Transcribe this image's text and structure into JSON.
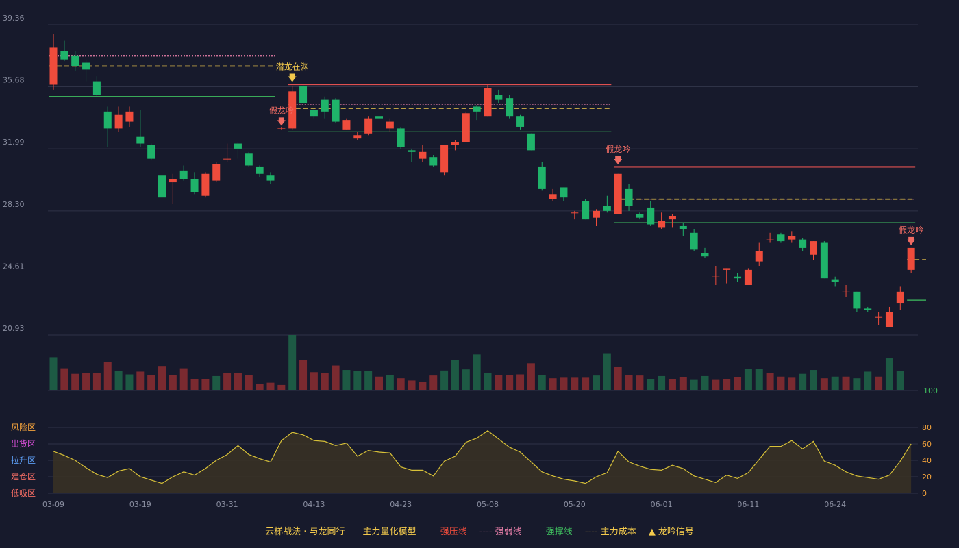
{
  "colors": {
    "background": "#171a2c",
    "grid": "#2f3347",
    "up": "#ef4c3c",
    "down": "#1fb36a",
    "resistance": "#e05050",
    "weak": "#e77ea8",
    "support": "#3fbf5f",
    "cost": "#f2c94c",
    "oscillator": "#d8c138",
    "axis_text": "#8a8ea0"
  },
  "chart_data": [
    {
      "type": "candlestick",
      "title": "",
      "ylim": [
        20.93,
        39.36
      ],
      "y_ticks": [
        "39.36",
        "35.68",
        "31.99",
        "28.30",
        "24.61",
        "20.93"
      ],
      "y_tick_values": [
        39.36,
        35.68,
        31.99,
        28.3,
        24.61,
        20.93
      ],
      "ohlc": [
        [
          35.8,
          38.0,
          35.5,
          38.8
        ],
        [
          37.8,
          37.3,
          37.2,
          38.4
        ],
        [
          37.5,
          36.9,
          36.6,
          37.8
        ],
        [
          37.1,
          36.7,
          36.0,
          37.3
        ],
        [
          36.0,
          35.2,
          35.1,
          36.3
        ],
        [
          34.2,
          33.2,
          32.1,
          34.5
        ],
        [
          33.2,
          34.0,
          33.0,
          34.5
        ],
        [
          33.6,
          34.2,
          33.3,
          34.5
        ],
        [
          32.7,
          32.3,
          32.1,
          34.3
        ],
        [
          32.2,
          31.4,
          31.3,
          32.3
        ],
        [
          30.4,
          29.1,
          28.9,
          30.5
        ],
        [
          30.0,
          30.2,
          28.7,
          30.5
        ],
        [
          30.7,
          30.2,
          30.1,
          31.0
        ],
        [
          30.2,
          29.4,
          29.3,
          30.6
        ],
        [
          29.2,
          30.5,
          29.1,
          30.6
        ],
        [
          30.1,
          31.1,
          30.0,
          31.2
        ],
        [
          31.4,
          31.4,
          31.2,
          32.3
        ],
        [
          32.3,
          32.0,
          31.4,
          32.4
        ],
        [
          31.7,
          31.0,
          30.9,
          31.8
        ],
        [
          30.9,
          30.5,
          30.3,
          31.0
        ],
        [
          30.4,
          30.1,
          29.9,
          30.6
        ],
        [
          33.2,
          33.2,
          33.1,
          33.3
        ],
        [
          33.2,
          35.4,
          33.1,
          35.7
        ],
        [
          35.7,
          34.7,
          34.5,
          35.8
        ],
        [
          34.3,
          33.9,
          33.8,
          34.4
        ],
        [
          34.9,
          34.2,
          33.8,
          35.1
        ],
        [
          34.9,
          33.6,
          33.5,
          35.0
        ],
        [
          33.1,
          33.7,
          33.1,
          33.8
        ],
        [
          32.6,
          32.8,
          32.5,
          33.0
        ],
        [
          32.9,
          33.8,
          32.8,
          33.9
        ],
        [
          33.9,
          33.8,
          33.5,
          34.0
        ],
        [
          33.2,
          33.6,
          33.0,
          33.8
        ],
        [
          33.2,
          32.1,
          32.0,
          33.3
        ],
        [
          31.9,
          31.8,
          31.2,
          32.0
        ],
        [
          31.4,
          31.8,
          31.2,
          32.2
        ],
        [
          31.5,
          31.0,
          30.9,
          31.6
        ],
        [
          30.6,
          32.2,
          30.4,
          32.2
        ],
        [
          32.2,
          32.4,
          31.9,
          32.5
        ],
        [
          32.4,
          34.1,
          32.4,
          34.2
        ],
        [
          34.5,
          34.2,
          33.7,
          34.6
        ],
        [
          33.9,
          35.6,
          33.9,
          35.8
        ],
        [
          35.2,
          34.9,
          34.7,
          35.5
        ],
        [
          35.0,
          33.9,
          33.8,
          35.2
        ],
        [
          33.9,
          33.3,
          33.1,
          34.0
        ],
        [
          32.9,
          31.9,
          31.9,
          32.9
        ],
        [
          30.9,
          29.6,
          29.5,
          31.2
        ],
        [
          29.0,
          29.3,
          28.9,
          29.6
        ],
        [
          29.7,
          29.1,
          28.9,
          29.7
        ],
        [
          28.2,
          28.2,
          27.8,
          28.3
        ],
        [
          28.9,
          27.8,
          27.8,
          29.0
        ],
        [
          27.9,
          28.3,
          27.4,
          28.4
        ],
        [
          28.6,
          28.3,
          28.2,
          29.2
        ],
        [
          28.1,
          30.5,
          28.1,
          30.5
        ],
        [
          29.6,
          28.6,
          28.3,
          29.9
        ],
        [
          28.1,
          27.9,
          27.8,
          28.2
        ],
        [
          28.5,
          27.5,
          27.4,
          28.9
        ],
        [
          27.3,
          27.7,
          27.2,
          28.2
        ],
        [
          27.8,
          28.0,
          27.3,
          28.1
        ],
        [
          27.4,
          27.2,
          26.8,
          27.6
        ],
        [
          27.0,
          26.0,
          25.9,
          27.2
        ],
        [
          25.8,
          25.6,
          25.5,
          26.1
        ],
        [
          24.4,
          24.4,
          23.9,
          25.0
        ],
        [
          24.8,
          24.9,
          24.0,
          24.9
        ],
        [
          24.4,
          24.3,
          24.1,
          24.6
        ],
        [
          23.9,
          24.8,
          23.9,
          24.9
        ],
        [
          25.3,
          25.9,
          25.0,
          26.4
        ],
        [
          26.6,
          26.6,
          26.4,
          27.0
        ],
        [
          26.9,
          26.5,
          26.4,
          27.0
        ],
        [
          26.6,
          26.8,
          26.4,
          27.1
        ],
        [
          26.6,
          26.1,
          25.9,
          26.7
        ],
        [
          25.7,
          26.5,
          25.4,
          26.5
        ],
        [
          26.4,
          24.3,
          24.3,
          26.5
        ],
        [
          24.2,
          24.1,
          23.8,
          24.4
        ],
        [
          23.5,
          23.5,
          23.2,
          23.9
        ],
        [
          23.5,
          22.5,
          22.3,
          23.5
        ],
        [
          22.5,
          22.4,
          22.3,
          22.6
        ],
        [
          22.0,
          22.0,
          21.5,
          22.3
        ],
        [
          21.4,
          22.3,
          21.4,
          22.6
        ],
        [
          22.8,
          23.5,
          22.4,
          23.8
        ],
        [
          24.8,
          26.1,
          24.6,
          26.1
        ]
      ],
      "x_tick_labels": [
        "03-09",
        "03-19",
        "03-31",
        "04-13",
        "04-23",
        "05-08",
        "05-20",
        "06-01",
        "06-11",
        "06-24"
      ],
      "x_tick_index": [
        0,
        8,
        16,
        24,
        32,
        40,
        48,
        56,
        64,
        72
      ],
      "lines": [
        {
          "kind": "resistance",
          "y": 35.8,
          "from": 22,
          "to": 51
        },
        {
          "kind": "resistance",
          "y": 30.9,
          "from": 52,
          "to": 79
        },
        {
          "kind": "weak",
          "y": 37.5,
          "from": 0,
          "to": 20
        },
        {
          "kind": "weak",
          "y": 34.6,
          "from": 22,
          "to": 51
        },
        {
          "kind": "weak",
          "y": 29.0,
          "from": 52,
          "to": 79
        },
        {
          "kind": "cost",
          "y": 36.9,
          "from": 0,
          "to": 20
        },
        {
          "kind": "cost",
          "y": 34.4,
          "from": 22,
          "to": 51
        },
        {
          "kind": "cost",
          "y": 29.0,
          "from": 52,
          "to": 79
        },
        {
          "kind": "cost",
          "y": 25.4,
          "from": 79,
          "to": 80
        },
        {
          "kind": "support",
          "y": 35.1,
          "from": 0,
          "to": 20
        },
        {
          "kind": "support",
          "y": 33.0,
          "from": 22,
          "to": 51
        },
        {
          "kind": "support",
          "y": 27.6,
          "from": 52,
          "to": 79
        },
        {
          "kind": "support",
          "y": 23.0,
          "from": 79,
          "to": 80
        }
      ],
      "signals": [
        {
          "label": "潜龙在渊",
          "index": 22,
          "y": 35.8,
          "color": "#f2c94c",
          "arrow": "down"
        },
        {
          "label": "假龙吟",
          "index": 21,
          "y": 33.2,
          "color": "#ef6b63",
          "arrow": "down"
        },
        {
          "label": "假龙吟",
          "index": 52,
          "y": 30.9,
          "color": "#ef6b63",
          "arrow": "down"
        },
        {
          "label": "假龙吟",
          "index": 79,
          "y": 26.1,
          "color": "#ef6b63",
          "arrow": "down"
        }
      ]
    },
    {
      "type": "bar",
      "title": "",
      "ylim": [
        0,
        100
      ],
      "y_ticks": [
        "100"
      ],
      "values": [
        60,
        40,
        30,
        31,
        31,
        51,
        35,
        29,
        34,
        28,
        43,
        28,
        40,
        21,
        20,
        26,
        31,
        31,
        28,
        12,
        14,
        10,
        100,
        55,
        33,
        32,
        45,
        37,
        35,
        35,
        25,
        28,
        22,
        18,
        16,
        27,
        36,
        55,
        38,
        65,
        32,
        28,
        28,
        29,
        49,
        28,
        22,
        23,
        23,
        23,
        27,
        66,
        42,
        28,
        27,
        20,
        26,
        20,
        24,
        19,
        26,
        19,
        20,
        24,
        39,
        39,
        31,
        25,
        23,
        30,
        37,
        22,
        25,
        25,
        22,
        34,
        25,
        58,
        35
      ],
      "up_flags": [
        0,
        1,
        1,
        1,
        1,
        1,
        0,
        0,
        1,
        1,
        1,
        1,
        1,
        1,
        1,
        0,
        1,
        1,
        1,
        1,
        1,
        1,
        0,
        1,
        1,
        1,
        1,
        0,
        0,
        0,
        1,
        0,
        1,
        1,
        1,
        1,
        0,
        0,
        0,
        0,
        0,
        1,
        1,
        1,
        1,
        0,
        1,
        1,
        1,
        1,
        0,
        0,
        1,
        1,
        1,
        0,
        0,
        1,
        1,
        0,
        0,
        1,
        1,
        1,
        0,
        0,
        1,
        1,
        1,
        0,
        0,
        1,
        0,
        1,
        0,
        0,
        1,
        0,
        0
      ]
    },
    {
      "type": "area",
      "title": "",
      "ylim": [
        0,
        100
      ],
      "y_ticks": [
        "100",
        "80",
        "60",
        "40",
        "20",
        "0"
      ],
      "zones": [
        {
          "label": "风险区",
          "color": "#f2a23c"
        },
        {
          "label": "出货区",
          "color": "#d94fd9"
        },
        {
          "label": "拉升区",
          "color": "#5b9bf0"
        },
        {
          "label": "建仓区",
          "color": "#ef6b63"
        },
        {
          "label": "低吸区",
          "color": "#ef6b63"
        }
      ],
      "values": [
        51,
        46,
        40,
        31,
        23,
        19,
        27,
        30,
        20,
        16,
        12,
        20,
        26,
        22,
        30,
        40,
        47,
        58,
        47,
        42,
        38,
        64,
        74,
        71,
        64,
        63,
        58,
        61,
        45,
        52,
        50,
        49,
        32,
        28,
        28,
        21,
        39,
        45,
        62,
        67,
        76,
        66,
        56,
        50,
        38,
        26,
        21,
        17,
        15,
        12,
        20,
        25,
        51,
        38,
        33,
        29,
        28,
        34,
        30,
        21,
        17,
        13,
        22,
        18,
        25,
        41,
        57,
        57,
        64,
        54,
        63,
        39,
        34,
        26,
        21,
        19,
        17,
        22,
        39,
        60
      ]
    }
  ],
  "legend": {
    "title": "云梯战法 · 与龙同行——主力量化模型",
    "items": [
      {
        "sym": "—",
        "label": "强压线",
        "color": "#ef4c3c"
      },
      {
        "sym": "----",
        "label": "强弱线",
        "color": "#e77ea8"
      },
      {
        "sym": "—",
        "label": "强撑线",
        "color": "#3fbf5f"
      },
      {
        "sym": "----",
        "label": "主力成本",
        "color": "#f2c94c"
      },
      {
        "sym": "▲",
        "label": "龙吟信号",
        "color": "#f2c94c"
      }
    ]
  }
}
